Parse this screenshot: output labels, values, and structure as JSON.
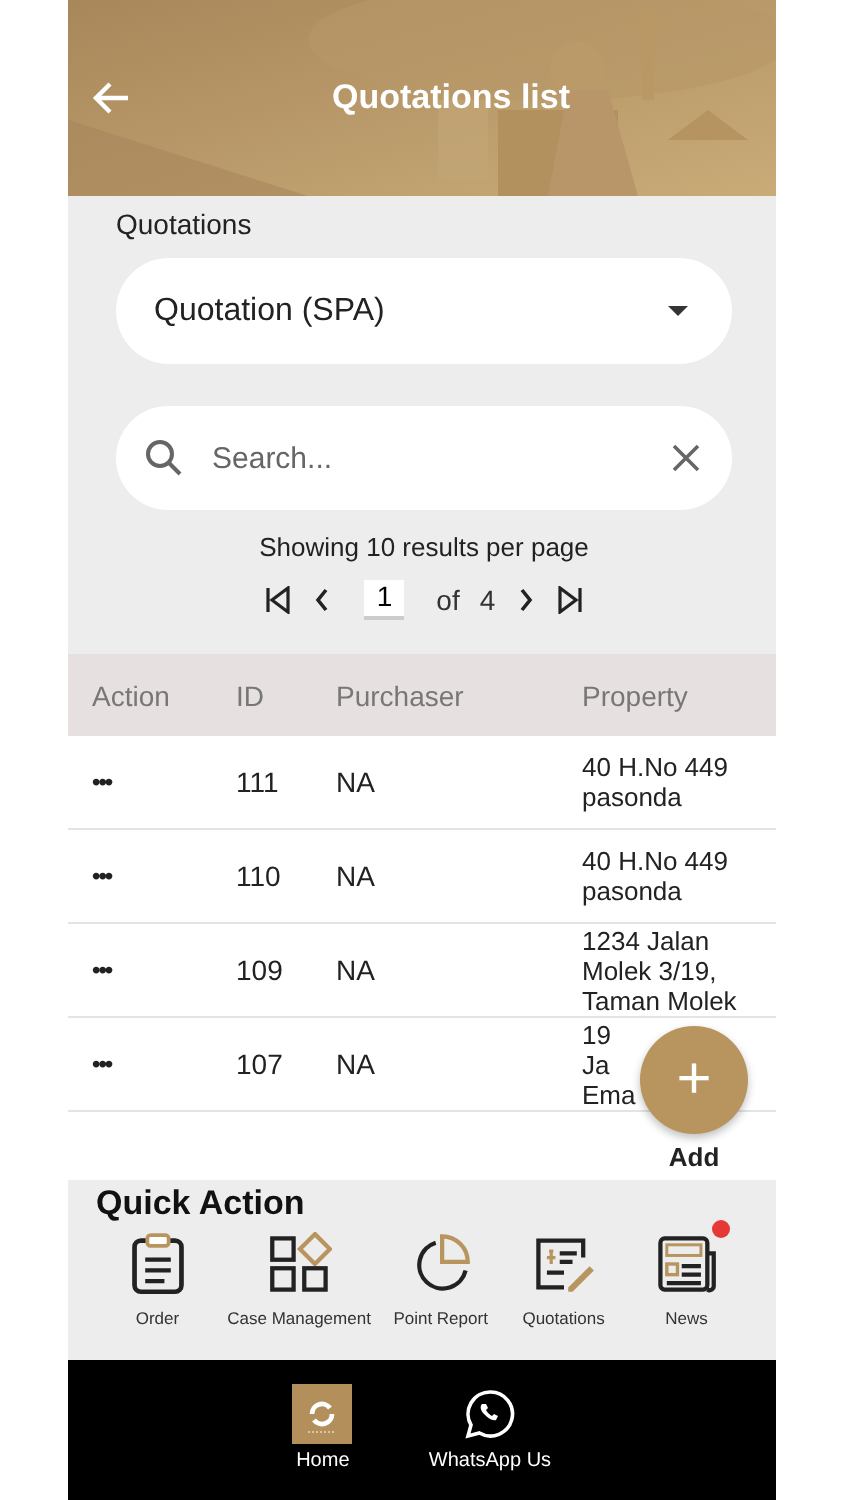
{
  "header": {
    "title": "Quotations list"
  },
  "type_select": {
    "label": "Quotations",
    "value": "Quotation (SPA)"
  },
  "search": {
    "placeholder": "Search..."
  },
  "pagination": {
    "summary": "Showing 10 results per page",
    "page": "1",
    "of": "of",
    "total": "4"
  },
  "table": {
    "columns": [
      "Action",
      "ID",
      "Purchaser",
      "Property"
    ],
    "rows": [
      {
        "action": "•••",
        "id": "111",
        "purchaser": "NA",
        "property": [
          "40 H.No 449",
          "pasonda"
        ]
      },
      {
        "action": "•••",
        "id": "110",
        "purchaser": "NA",
        "property": [
          "40 H.No 449",
          "pasonda"
        ]
      },
      {
        "action": "•••",
        "id": "109",
        "purchaser": "NA",
        "property": [
          "1234 Jalan",
          "Molek 3/19,",
          "Taman Molek"
        ]
      },
      {
        "action": "•••",
        "id": "107",
        "purchaser": "NA",
        "property": [
          "19",
          "Ja",
          "Ema"
        ]
      }
    ]
  },
  "fab": {
    "icon": "+",
    "label": "Add"
  },
  "quick_action": {
    "title": "Quick Action",
    "items": [
      {
        "kind": "order",
        "label": "Order",
        "badge": false
      },
      {
        "kind": "case",
        "label": "Case Management",
        "badge": false
      },
      {
        "kind": "report",
        "label": "Point Report",
        "badge": false
      },
      {
        "kind": "quotation",
        "label": "Quotations",
        "badge": false
      },
      {
        "kind": "news",
        "label": "News",
        "badge": true
      }
    ]
  },
  "bottom_nav": [
    {
      "kind": "home",
      "label": "Home"
    },
    {
      "kind": "whatsapp",
      "label": "WhatsApp Us"
    }
  ]
}
